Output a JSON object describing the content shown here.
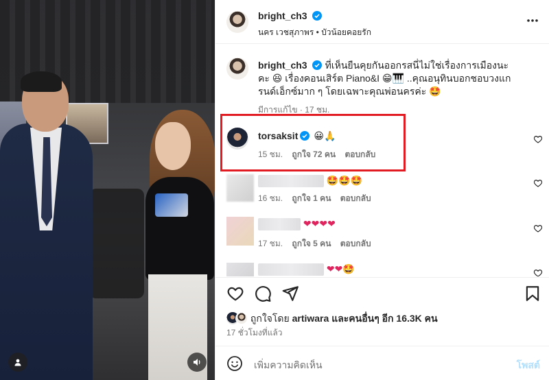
{
  "header": {
    "username": "bright_ch3",
    "subtitle": "นคร เวชสุภาพร • บัวน้อยคอยรัก",
    "more_icon": "more-horizontal-icon"
  },
  "caption": {
    "username": "bright_ch3",
    "text": "ที่เห็นยืนคุยกันออกรสนี่ไม่ใช่เรื่องการเมืองนะคะ 😆 เรื่องคอนเสิร์ต Piano&I 😁🎹 ..คุณอนุทินบอกชอบวงแกรนด์เอ็กซ์มาก ๆ โดยเฉพาะคุณพ่อนครค่ะ 🤩",
    "edited": "มีการแก้ไข · 17 ชม."
  },
  "comments": [
    {
      "username": "torsaksit",
      "text": "😀🙏",
      "time": "15 ชม.",
      "likes": "ถูกใจ 72 คน",
      "reply": "ตอบกลับ"
    },
    {
      "username": "",
      "text": "🤩🤩🤩",
      "time": "16 ชม.",
      "likes": "ถูกใจ 1 คน",
      "reply": "ตอบกลับ"
    },
    {
      "username": "",
      "text": "❤❤❤❤",
      "time": "17 ชม.",
      "likes": "ถูกใจ 5 คน",
      "reply": "ตอบกลับ"
    },
    {
      "username": "",
      "text": "❤❤🤩",
      "time": "",
      "likes": "",
      "reply": ""
    }
  ],
  "liked_by": {
    "prefix": "ถูกใจโดย",
    "user": "artiwara",
    "middle": "และคนอื่นๆ",
    "count": "อีก 16.3K คน"
  },
  "posted_time": "17 ชั่วโมงที่แล้ว",
  "add_comment": {
    "placeholder": "เพิ่มความคิดเห็น",
    "post_label": "โพสต์"
  },
  "colors": {
    "verified": "#0095f6",
    "highlight": "#e21a22",
    "post_disabled": "#b2dffc"
  }
}
